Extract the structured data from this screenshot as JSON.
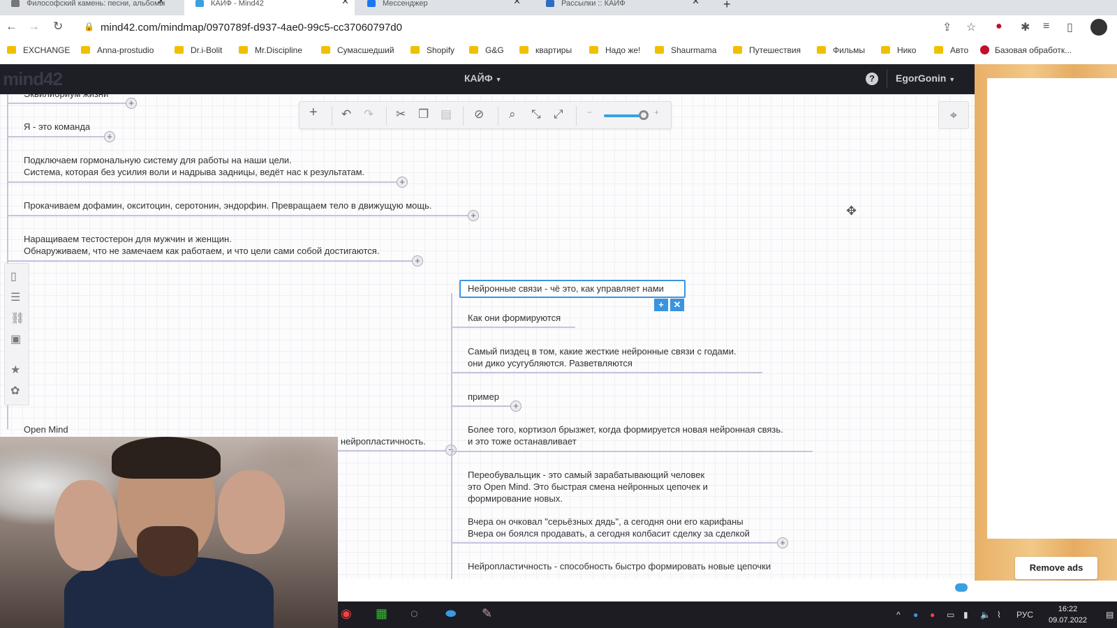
{
  "browser": {
    "tabs": [
      {
        "title": "Философский камень: песни, альбомы"
      },
      {
        "title": "КАЙФ - Mind42"
      },
      {
        "title": "Мессенджер"
      },
      {
        "title": "Рассылки :: КАЙФ"
      }
    ],
    "url": "mind42.com/mindmap/0970789f-d937-4ae0-99c5-cc37060797d0",
    "bookmarks": [
      "EXCHANGE",
      "Anna-prostudio",
      "Dr.i-Bolit",
      "Mr.Discipline",
      "Сумасшедший",
      "Shopify",
      "G&G",
      "квартиры",
      "Надо же!",
      "Shaurmama",
      "Путешествия",
      "Фильмы",
      "Нико",
      "Авто",
      "Базовая обработк..."
    ]
  },
  "app": {
    "logo": "mind42",
    "map_title": "КАЙФ",
    "user": "EgorGonin",
    "remove_ads": "Remove ads"
  },
  "nodes": {
    "n1": "Эквилибриум жизни",
    "n2": "Я - это команда",
    "n3a": "Подключаем гормональную систему для работы на наши цели.",
    "n3b": "Система, которая без усилия воли и надрыва задницы, ведёт нас к результатам.",
    "n4": "Прокачиваем дофамин, окситоцин, серотонин, эндорфин. Превращаем тело в движущую мощь.",
    "n5a": "Наращиваем тестостерон для мужчин и женщин.",
    "n5b": "Обнаруживаем, что не замечаем как работаем, и что цели сами собой достигаются.",
    "n6": "Open Mind",
    "parent": "нейропластичность.",
    "editing": "Нейронные связи - чё это, как управляет нами",
    "c1": "Как они формируются",
    "c2a": "Самый пиздец в том, какие жесткие нейронные связи с годами.",
    "c2b": "они дико усугубляются. Разветвляются",
    "c3": "пример",
    "c4a": "Более того, кортизол брызжет, когда формируется новая нейронная связь.",
    "c4b": "и это тоже останавливает",
    "c5a": "Переобувальщик - это самый зарабатывающий человек",
    "c5b": "это Open Mind. Это быстрая смена нейронных цепочек и",
    "c5c": "формирование новых.",
    "c6a": "Вчера он очковал \"серьёзных дядь\", а сегодня они его карифаны",
    "c6b": "Вчера он боялся продавать, а сегодня колбасит сделку за сделкой",
    "c7": "Нейропластичность - способность быстро формировать новые цепочки"
  },
  "taskbar": {
    "lang": "РУС",
    "time": "16:22",
    "date": "09.07.2022"
  },
  "icons": {
    "add": "plus-icon",
    "undo": "undo-icon",
    "redo": "redo-icon",
    "cut": "cut-icon",
    "copy": "copy-icon",
    "paste": "paste-icon",
    "delete": "forbidden-icon",
    "search": "search-icon",
    "fit": "collapse-icon",
    "expand": "expand-icon"
  },
  "colors": {
    "accent": "#3a94e0",
    "header": "#1e1e26"
  }
}
